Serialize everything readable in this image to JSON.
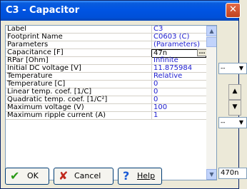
{
  "window": {
    "title": "C3 - Capacitor",
    "close_label": "✕"
  },
  "properties": [
    {
      "label": "Label",
      "value": "C3"
    },
    {
      "label": "Footprint Name",
      "value": "C0603 (C)"
    },
    {
      "label": "Parameters",
      "value": "(Parameters)"
    },
    {
      "label": "Capacitance  [F]",
      "value": "47n"
    },
    {
      "label": "RPar      [Ohm]",
      "value": "Infinite"
    },
    {
      "label": "Initial DC voltage  [V]",
      "value": "11.875984"
    },
    {
      "label": "Temperature",
      "value": "Relative"
    },
    {
      "label": "Temperature [C]",
      "value": "0"
    },
    {
      "label": "Linear temp. coef. [1/C]",
      "value": "0"
    },
    {
      "label": "Quadratic temp. coef. [1/C²]",
      "value": "0"
    },
    {
      "label": "Maximum voltage (V)",
      "value": "100"
    },
    {
      "label": "Maximum ripple current (A)",
      "value": "1"
    }
  ],
  "ellipsis_label": "...",
  "side": {
    "combo1": "--",
    "combo2": "--",
    "input_value": "470n"
  },
  "buttons": {
    "ok_label": "OK",
    "cancel_label": "Cancel",
    "help_label": "Help"
  }
}
